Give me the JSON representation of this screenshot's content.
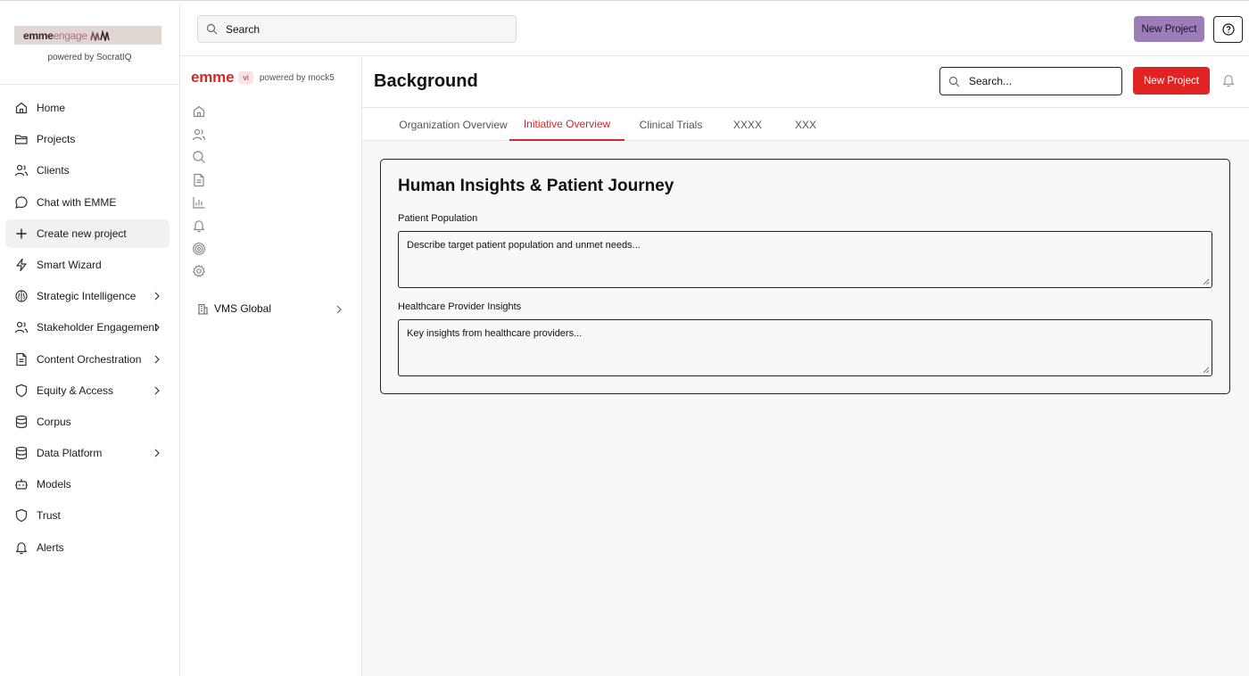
{
  "brand": {
    "logo_part1": "emme",
    "logo_part2": "engage",
    "powered_by": "powered by SocratIQ"
  },
  "sidebar": {
    "items": [
      {
        "label": "Home",
        "icon": "home-icon"
      },
      {
        "label": "Projects",
        "icon": "folder-icon"
      },
      {
        "label": "Clients",
        "icon": "users-icon"
      },
      {
        "label": "Chat with EMME",
        "icon": "chat-icon"
      },
      {
        "label": "Create new project",
        "icon": "plus-icon",
        "active": true
      },
      {
        "label": "Smart Wizard",
        "icon": "lightning-icon"
      },
      {
        "label": "Strategic Intelligence",
        "icon": "brain-icon",
        "expandable": true
      },
      {
        "label": "Stakeholder Engagement",
        "icon": "users-icon",
        "expandable": true
      },
      {
        "label": "Content Orchestration",
        "icon": "document-icon",
        "expandable": true
      },
      {
        "label": "Equity & Access",
        "icon": "shield-icon",
        "expandable": true
      },
      {
        "label": "Corpus",
        "icon": "database-icon"
      },
      {
        "label": "Data Platform",
        "icon": "database-icon",
        "expandable": true
      },
      {
        "label": "Models",
        "icon": "bot-icon"
      },
      {
        "label": "Trust",
        "icon": "shield-icon"
      },
      {
        "label": "Alerts",
        "icon": "bell-icon"
      }
    ]
  },
  "topbar": {
    "search_placeholder": "Search",
    "new_project_label": "New Project",
    "help_icon": "help-circle-icon",
    "accent_color": "#9c7db8"
  },
  "panel": {
    "brand_name": "emme",
    "brand_badge": "vi",
    "powered_by": "powered by mock5",
    "icons": [
      "home-icon",
      "users-icon",
      "search-icon",
      "document-icon",
      "chart-icon",
      "bell-icon",
      "target-icon",
      "gear-icon"
    ],
    "workspace_label": "VMS Global",
    "accent_color": "#d62828"
  },
  "main": {
    "title": "Background",
    "search_placeholder": "Search...",
    "new_project_label": "New Project",
    "tabs": [
      {
        "label": "Organization Overview"
      },
      {
        "label": "Initiative Overview",
        "active": true
      },
      {
        "label": "Clinical Trials"
      },
      {
        "label": "XXXX"
      },
      {
        "label": "XXX"
      }
    ],
    "card": {
      "title": "Human Insights & Patient Journey",
      "fields": [
        {
          "label": "Patient Population",
          "placeholder": "Describe target patient population and unmet needs..."
        },
        {
          "label": "Healthcare Provider Insights",
          "placeholder": "Key insights from healthcare providers..."
        }
      ]
    }
  }
}
